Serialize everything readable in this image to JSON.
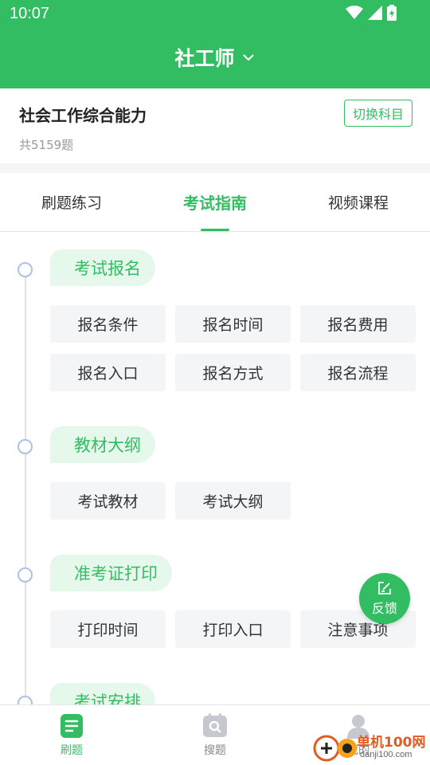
{
  "status_bar": {
    "time": "10:07"
  },
  "header": {
    "title": "社工师"
  },
  "subject": {
    "name": "社会工作综合能力",
    "count": "共5159题",
    "switch_label": "切换科目"
  },
  "tabs": [
    {
      "label": "刷题练习"
    },
    {
      "label": "考试指南"
    },
    {
      "label": "视频课程"
    }
  ],
  "sections": [
    {
      "title": "考试报名",
      "options": [
        "报名条件",
        "报名时间",
        "报名费用",
        "报名入口",
        "报名方式",
        "报名流程"
      ]
    },
    {
      "title": "教材大纲",
      "options": [
        "考试教材",
        "考试大纲"
      ]
    },
    {
      "title": "准考证打印",
      "options": [
        "打印时间",
        "打印入口",
        "注意事项"
      ]
    },
    {
      "title": "考试安排",
      "options": []
    }
  ],
  "feedback": {
    "label": "反馈"
  },
  "bottom_nav": [
    {
      "label": "刷题"
    },
    {
      "label": "搜题"
    },
    {
      "label": "我的"
    }
  ],
  "watermark": {
    "line1": "单机100网",
    "line2": "danji100.com"
  },
  "colors": {
    "primary": "#33bd62",
    "pill_bg": "#e6f8ec",
    "option_bg": "#f4f5f7",
    "timeline_dot": "#a9c2e6"
  },
  "active_tab_index": 1,
  "active_nav_index": 0
}
